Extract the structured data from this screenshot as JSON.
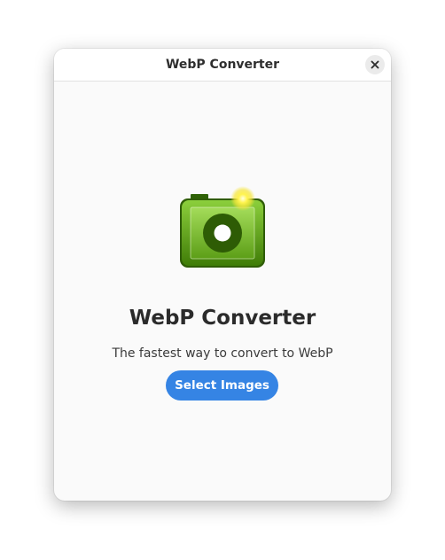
{
  "window": {
    "title": "WebP Converter"
  },
  "header": {
    "close_icon": "close-icon"
  },
  "welcome": {
    "app_icon": "camera-image-icon",
    "app_name": "WebP Converter",
    "tagline": "The fastest way to convert to WebP",
    "select_button_label": "Select Images"
  },
  "colors": {
    "accent": "#3584e4",
    "icon_green": "#4e9a06"
  }
}
